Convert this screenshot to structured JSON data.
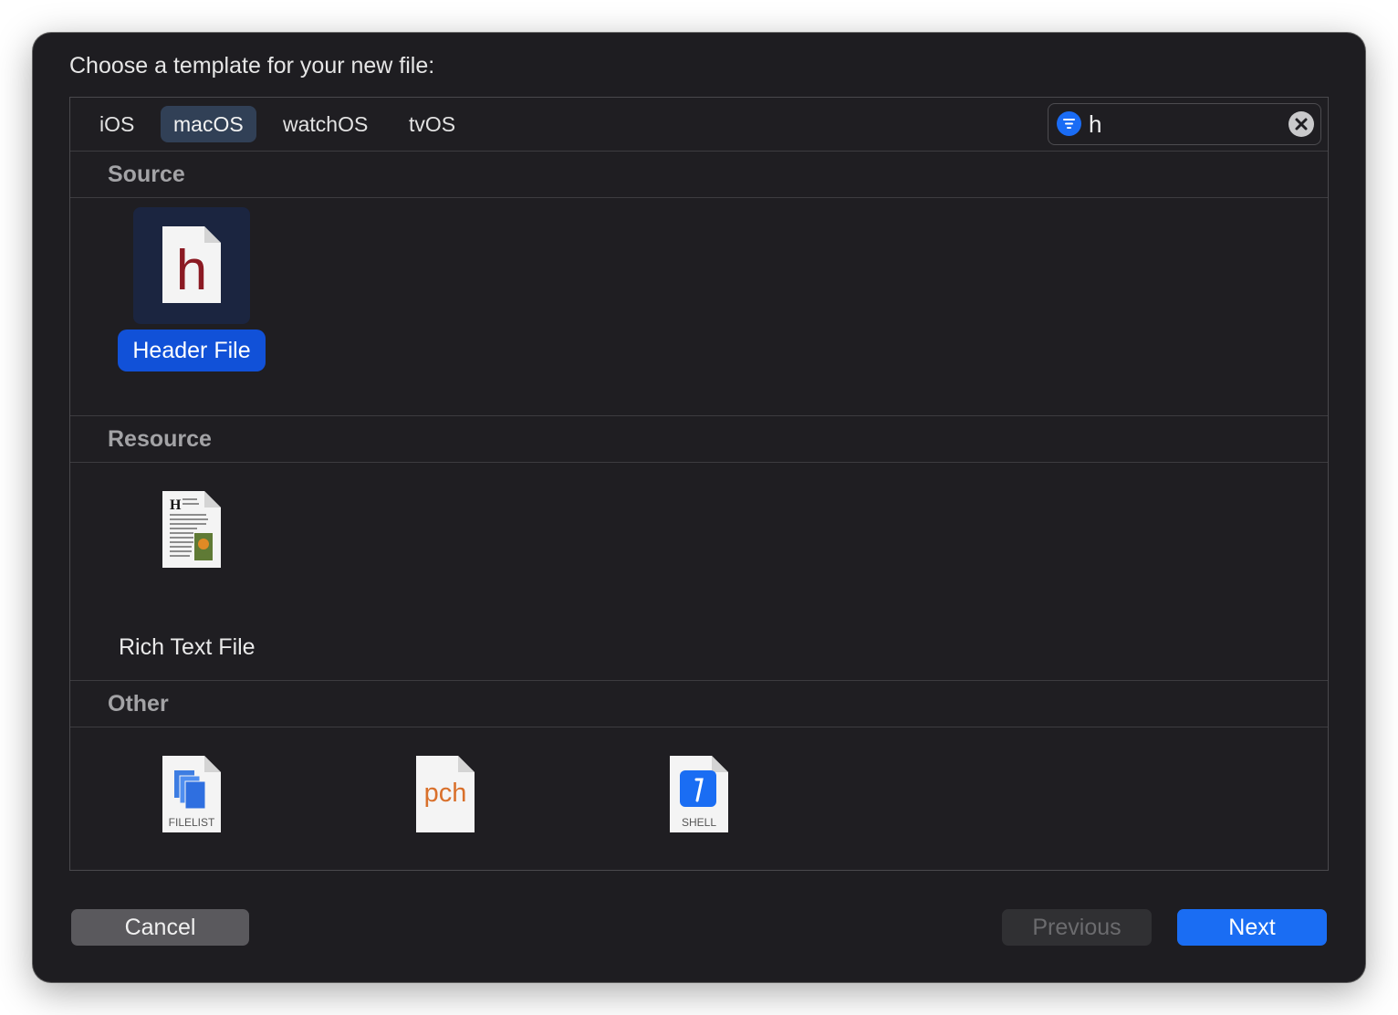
{
  "dialog": {
    "title": "Choose a template for your new file:"
  },
  "platforms": {
    "tabs": [
      {
        "label": "iOS"
      },
      {
        "label": "macOS",
        "selected": true
      },
      {
        "label": "watchOS"
      },
      {
        "label": "tvOS"
      }
    ]
  },
  "search": {
    "value": "h",
    "filter_icon": "filter-icon",
    "clear_icon": "clear-icon"
  },
  "sections": [
    {
      "title": "Source",
      "items": [
        {
          "label": "Header File",
          "icon": "header-file-icon",
          "selected": true
        }
      ]
    },
    {
      "title": "Resource",
      "items": [
        {
          "label": "Rich Text File",
          "icon": "rich-text-file-icon"
        }
      ]
    },
    {
      "title": "Other",
      "items": [
        {
          "label": "",
          "icon": "filelist-file-icon",
          "icon_text": "FILELIST"
        },
        {
          "label": "",
          "icon": "pch-file-icon",
          "icon_text": "pch"
        },
        {
          "label": "",
          "icon": "shell-script-file-icon",
          "icon_text": "SHELL"
        }
      ]
    }
  ],
  "header_icon_glyph": "h",
  "rtf_icon_glyph": "H",
  "footer": {
    "cancel_label": "Cancel",
    "previous_label": "Previous",
    "next_label": "Next"
  },
  "colors": {
    "accent": "#1151d8",
    "header_glyph": "#8b1a23",
    "pch_glyph": "#d9702b",
    "shell_badge": "#1a6df3"
  }
}
